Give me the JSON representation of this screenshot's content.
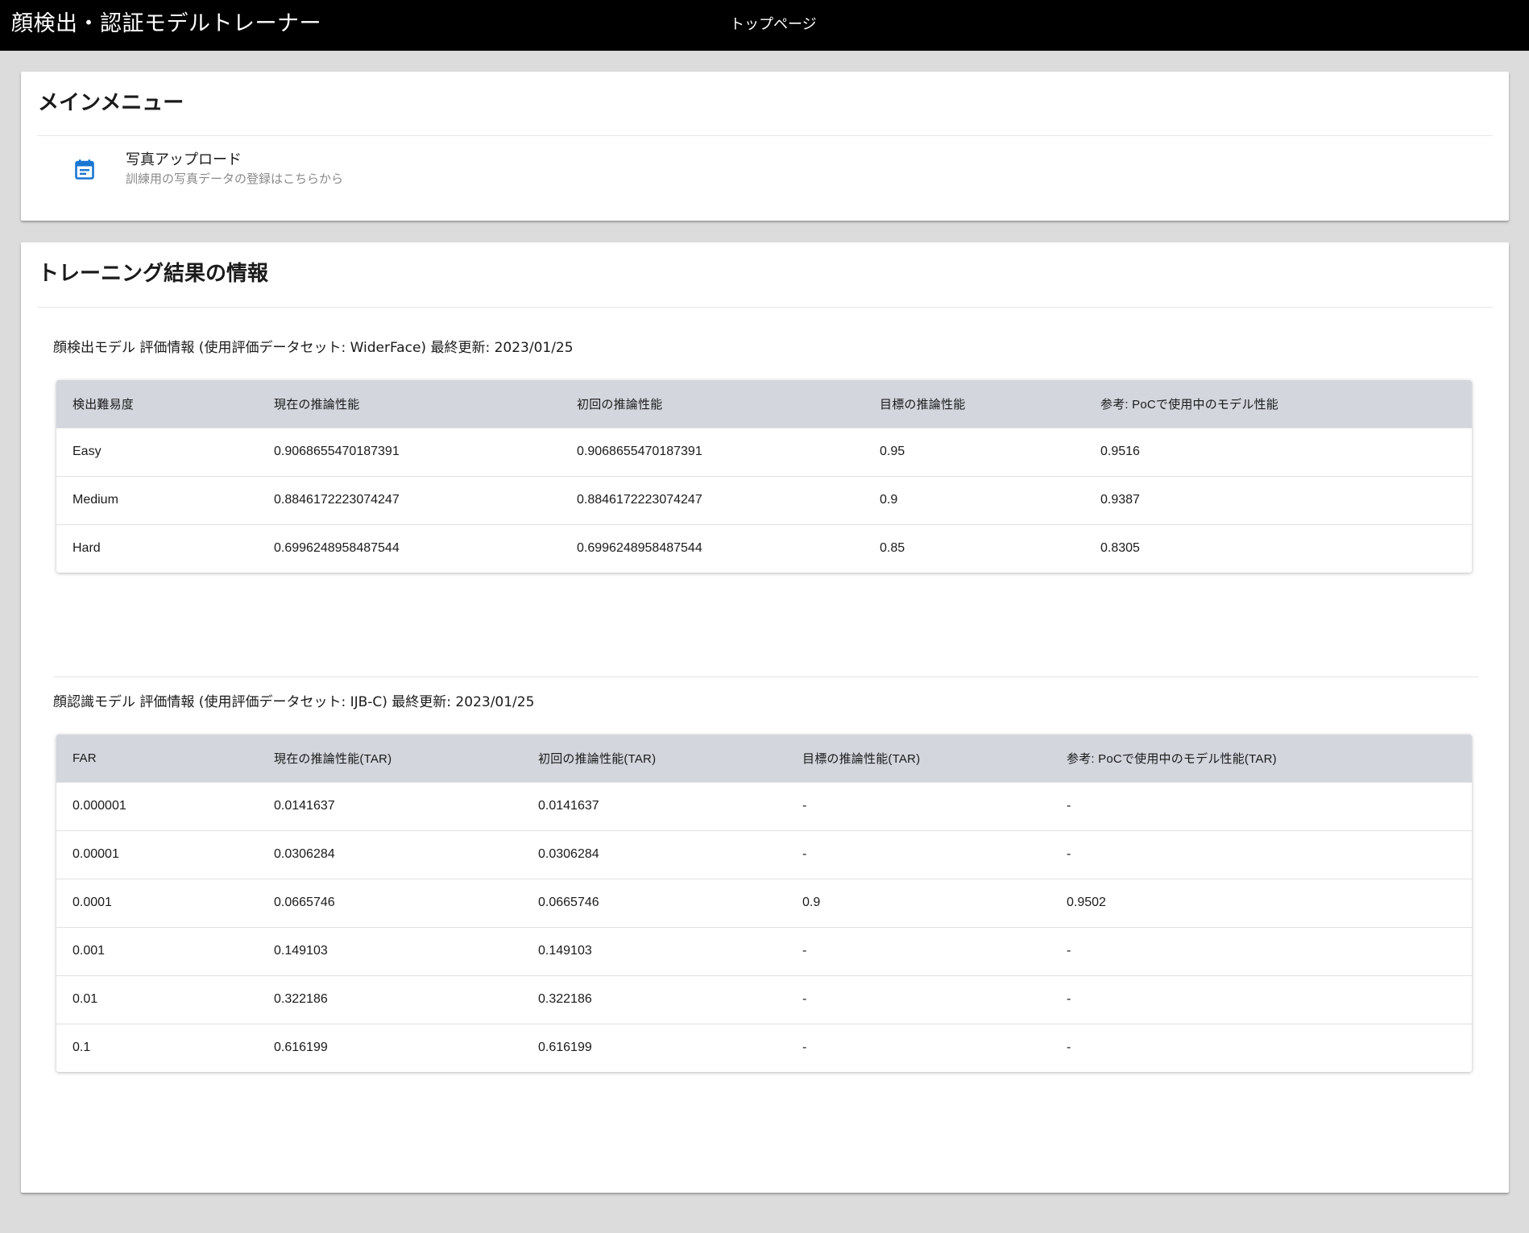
{
  "appbar": {
    "title": "顔検出・認証モデルトレーナー",
    "page": "トップページ"
  },
  "main_menu": {
    "title": "メインメニュー",
    "items": [
      {
        "icon": "calendar-note-icon",
        "label": "写真アップロード",
        "description": "訓練用の写真データの登録はこちらから"
      }
    ]
  },
  "results": {
    "title": "トレーニング結果の情報",
    "detection": {
      "heading": "顔検出モデル 評価情報 (使用評価データセット: WiderFace) 最終更新: 2023/01/25",
      "columns": [
        "検出難易度",
        "現在の推論性能",
        "初回の推論性能",
        "目標の推論性能",
        "参考: PoCで使用中のモデル性能"
      ],
      "rows": [
        [
          "Easy",
          "0.9068655470187391",
          "0.9068655470187391",
          "0.95",
          "0.9516"
        ],
        [
          "Medium",
          "0.8846172223074247",
          "0.8846172223074247",
          "0.9",
          "0.9387"
        ],
        [
          "Hard",
          "0.6996248958487544",
          "0.6996248958487544",
          "0.85",
          "0.8305"
        ]
      ]
    },
    "recognition": {
      "heading": "顔認識モデル 評価情報 (使用評価データセット: IJB-C) 最終更新: 2023/01/25",
      "columns": [
        "FAR",
        "現在の推論性能(TAR)",
        "初回の推論性能(TAR)",
        "目標の推論性能(TAR)",
        "参考: PoCで使用中のモデル性能(TAR)"
      ],
      "rows": [
        [
          "0.000001",
          "0.0141637",
          "0.0141637",
          "-",
          "-"
        ],
        [
          "0.00001",
          "0.0306284",
          "0.0306284",
          "-",
          "-"
        ],
        [
          "0.0001",
          "0.0665746",
          "0.0665746",
          "0.9",
          "0.9502"
        ],
        [
          "0.001",
          "0.149103",
          "0.149103",
          "-",
          "-"
        ],
        [
          "0.01",
          "0.322186",
          "0.322186",
          "-",
          "-"
        ],
        [
          "0.1",
          "0.616199",
          "0.616199",
          "-",
          "-"
        ]
      ]
    }
  },
  "colors": {
    "appbar_bg": "#000000",
    "page_bg": "#dcdcdc",
    "table_header_bg": "#d3d6dd",
    "icon_accent": "#1976d2"
  }
}
